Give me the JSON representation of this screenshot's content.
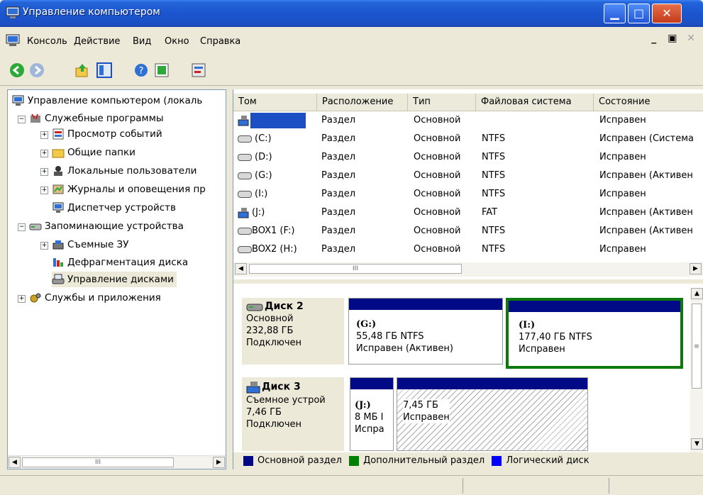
{
  "window": {
    "title": "Управление компьютером"
  },
  "menu": [
    "Консоль",
    "Действие",
    "Вид",
    "Окно",
    "Справка"
  ],
  "toolbar_icons": [
    "back-icon",
    "forward-icon",
    "up-folder-icon",
    "show-tree-icon",
    "help-icon",
    "export-icon",
    "properties-icon"
  ],
  "tree": {
    "root": "Управление компьютером (локаль",
    "items": [
      {
        "label": "Служебные программы",
        "icon": "tools-icon"
      },
      {
        "label": "Просмотр событий",
        "icon": "event-viewer-icon"
      },
      {
        "label": "Общие папки",
        "icon": "shared-folders-icon"
      },
      {
        "label": "Локальные пользователи",
        "icon": "local-users-icon"
      },
      {
        "label": "Журналы и оповещения пр",
        "icon": "logs-alerts-icon"
      },
      {
        "label": "Диспетчер устройств",
        "icon": "device-manager-icon"
      },
      {
        "label": "Запоминающие устройства",
        "icon": "storage-icon"
      },
      {
        "label": "Съемные ЗУ",
        "icon": "removable-storage-icon"
      },
      {
        "label": "Дефрагментация диска",
        "icon": "defrag-icon"
      },
      {
        "label": "Управление дисками",
        "icon": "disk-management-icon"
      },
      {
        "label": "Службы и приложения",
        "icon": "services-icon"
      }
    ]
  },
  "list": {
    "columns": [
      "Том",
      "Расположение",
      "Тип",
      "Файловая система",
      "Состояние"
    ],
    "rows": [
      [
        "",
        "Раздел",
        "Основной",
        "",
        "Исправен"
      ],
      [
        "(C:)",
        "Раздел",
        "Основной",
        "NTFS",
        "Исправен (Система"
      ],
      [
        "(D:)",
        "Раздел",
        "Основной",
        "NTFS",
        "Исправен"
      ],
      [
        "(G:)",
        "Раздел",
        "Основной",
        "NTFS",
        "Исправен (Активен"
      ],
      [
        "(I:)",
        "Раздел",
        "Основной",
        "NTFS",
        "Исправен"
      ],
      [
        "(J:)",
        "Раздел",
        "Основной",
        "FAT",
        "Исправен (Активен"
      ],
      [
        "BOX1 (F:)",
        "Раздел",
        "Основной",
        "NTFS",
        "Исправен (Активен"
      ],
      [
        "BOX2 (H:)",
        "Раздел",
        "Основной",
        "NTFS",
        "Исправен"
      ]
    ]
  },
  "disks": [
    {
      "name": "Диск 2",
      "type": "Основной",
      "size": "232,88 ГБ",
      "status": "Подключен",
      "volumes": [
        {
          "label": "(G:)",
          "size": "55,48 ГБ NTFS",
          "status": "Исправен (Активен)"
        },
        {
          "label": "(I:)",
          "size": "177,40 ГБ NTFS",
          "status": "Исправен"
        }
      ]
    },
    {
      "name": "Диск 3",
      "type": "Съемное устрой",
      "size": "7,46 ГБ",
      "status": "Подключен",
      "volumes": [
        {
          "label": "(J:)",
          "size": "8 МБ I",
          "status": "Испра"
        },
        {
          "label": "",
          "size": "7,45 ГБ",
          "status": "Исправен"
        }
      ]
    }
  ],
  "legend": [
    {
      "label": "Основной раздел",
      "color": "#000a86"
    },
    {
      "label": "Дополнительный раздел",
      "color": "#008000"
    },
    {
      "label": "Логический диск",
      "color": "#0000ff"
    }
  ],
  "scroll_thumb": "III"
}
